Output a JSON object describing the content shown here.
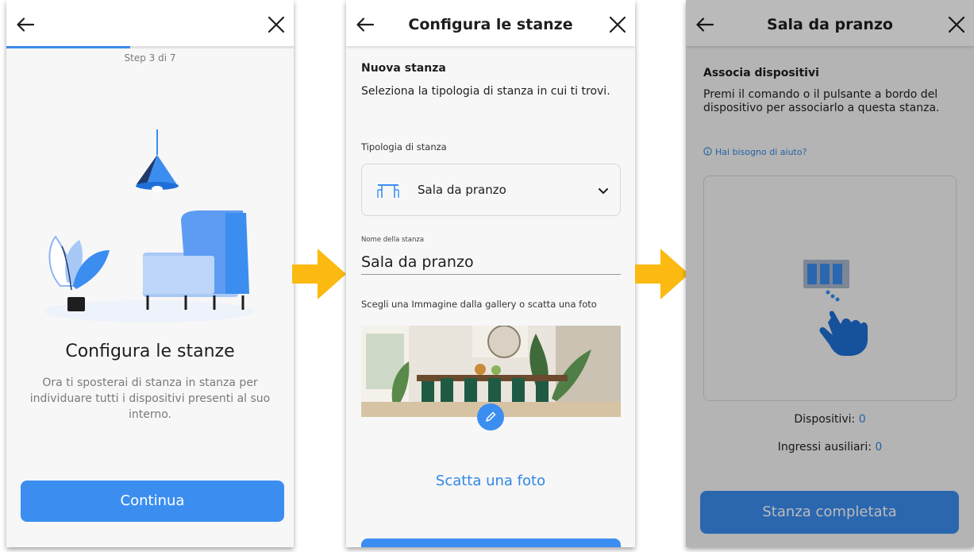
{
  "colors": {
    "accent": "#3b8ef0",
    "link": "#2f87e6",
    "arrow": "#fbb911",
    "background": "#f7f7f7"
  },
  "screen1": {
    "step_label": "Step 3 di 7",
    "progress": 0.43,
    "title": "Configura le stanze",
    "description": "Ora ti sposterai di stanza in stanza per individuare tutti i dispositivi presenti al suo interno.",
    "continue_label": "Continua",
    "icons": {
      "back": "arrow-left-icon",
      "close": "close-icon",
      "illustration": "lamp-armchair-plant-illustration"
    }
  },
  "screen2": {
    "title": "Configura le stanze",
    "heading": "Nuova stanza",
    "instruction": "Seleziona la tipologia di stanza in cui ti trovi.",
    "room_type_label": "Tipologia di stanza",
    "room_type_value": "Sala da pranzo",
    "room_name_label": "Nome della stanza",
    "room_name_value": "Sala da pranzo",
    "gallery_label": "Scegli una Immagine dalla gallery o scatta una foto",
    "photo_button": "Scatta una foto",
    "icons": {
      "room_type": "dining-table-icon",
      "dropdown": "chevron-down-icon",
      "edit": "pencil-icon"
    }
  },
  "screen3": {
    "title": "Sala da pranzo",
    "heading": "Associa dispositivi",
    "instruction": "Premi il comando o il pulsante a bordo del dispositivo per associarlo a questa stanza.",
    "help_link": "Hai bisogno di aiuto?",
    "devices_label": "Dispositivi:",
    "devices_count": "0",
    "aux_label": "Ingressi ausiliari:",
    "aux_count": "0",
    "complete_label": "Stanza completata",
    "icons": {
      "help": "info-icon",
      "pairing": "press-button-hand-icon"
    }
  }
}
